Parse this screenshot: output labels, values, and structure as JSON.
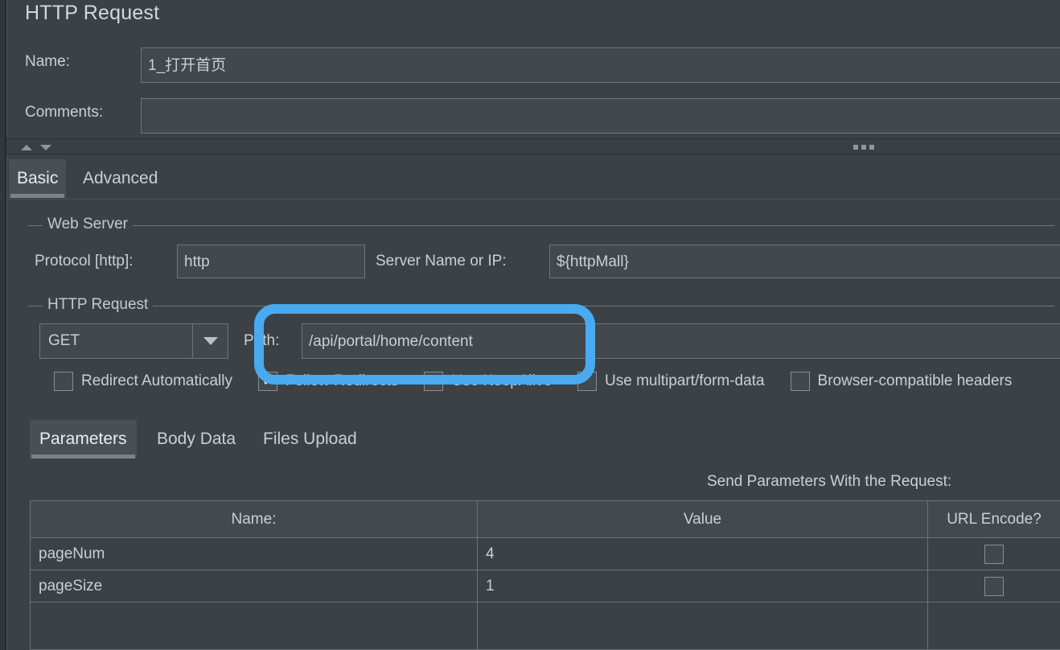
{
  "panel": {
    "title": "HTTP Request",
    "name_label": "Name:",
    "name_value": "1_打开首页",
    "comments_label": "Comments:",
    "comments_value": "",
    "comments_placeholder": ""
  },
  "splitter": {
    "collapse_up_icon": "triangle-up-icon",
    "collapse_down_icon": "triangle-down-icon",
    "grip_icon": "splitter-grip-icon"
  },
  "tabs": [
    {
      "label": "Basic",
      "active": true
    },
    {
      "label": "Advanced",
      "active": false
    }
  ],
  "web_server": {
    "group_title": "Web Server",
    "protocol_label": "Protocol [http]:",
    "protocol_value": "http",
    "server_label": "Server Name or IP:",
    "server_value": "${httpMall}"
  },
  "http_request": {
    "group_title": "HTTP Request",
    "method_value": "GET",
    "method_caret_icon": "chevron-down-icon",
    "path_label": "Path:",
    "path_value": "/api/portal/home/content",
    "checkboxes": [
      {
        "label": "Redirect Automatically",
        "checked": false
      },
      {
        "label": "Follow Redirects",
        "checked": true
      },
      {
        "label": "Use KeepAlive",
        "checked": true
      },
      {
        "label": "Use multipart/form-data",
        "checked": false
      },
      {
        "label": "Browser-compatible headers",
        "checked": false
      }
    ]
  },
  "sub_tabs": [
    {
      "label": "Parameters",
      "active": true
    },
    {
      "label": "Body Data",
      "active": false
    },
    {
      "label": "Files Upload",
      "active": false
    }
  ],
  "parameters": {
    "send_label": "Send Parameters With the Request:",
    "columns": [
      "Name:",
      "Value",
      "URL Encode?"
    ],
    "rows": [
      {
        "name": "pageNum",
        "value": "4",
        "url_encode": false
      },
      {
        "name": "pageSize",
        "value": "1",
        "url_encode": false
      }
    ]
  },
  "annotation": {
    "target": "path-input",
    "color": "#4aaaf0"
  }
}
